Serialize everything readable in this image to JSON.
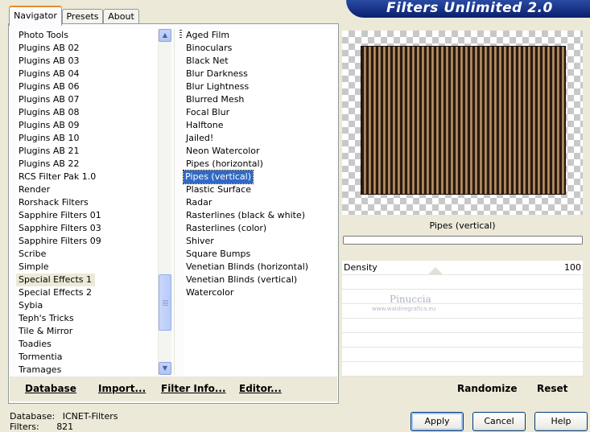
{
  "banner": {
    "title": "Filters Unlimited 2.0"
  },
  "tabs": [
    {
      "label": "Navigator",
      "active": true
    },
    {
      "label": "Presets",
      "active": false
    },
    {
      "label": "About",
      "active": false
    }
  ],
  "categories": {
    "items": [
      "Photo Tools",
      "Plugins AB 02",
      "Plugins AB 03",
      "Plugins AB 04",
      "Plugins AB 06",
      "Plugins AB 07",
      "Plugins AB 08",
      "Plugins AB 09",
      "Plugins AB 10",
      "Plugins AB 21",
      "Plugins AB 22",
      "RCS Filter Pak 1.0",
      "Render",
      "Rorshack Filters",
      "Sapphire Filters 01",
      "Sapphire Filters 03",
      "Sapphire Filters 09",
      "Scribe",
      "Simple",
      "Special Effects 1",
      "Special Effects 2",
      "Sybia",
      "Teph's Tricks",
      "Tile & Mirror",
      "Toadies",
      "Tormentia",
      "Tramages"
    ],
    "selected_index": 19
  },
  "filters": {
    "items": [
      "Aged Film",
      "Binoculars",
      "Black Net",
      "Blur Darkness",
      "Blur Lightness",
      "Blurred Mesh",
      "Focal Blur",
      "Halftone",
      "Jailed!",
      "Neon Watercolor",
      "Pipes (horizontal)",
      "Pipes (vertical)",
      "Plastic Surface",
      "Radar",
      "Rasterlines (black & white)",
      "Rasterlines (color)",
      "Shiver",
      "Square Bumps",
      "Venetian Blinds (horizontal)",
      "Venetian Blinds (vertical)",
      "Watercolor"
    ],
    "selected_index": 11
  },
  "left_buttons": {
    "database": "Database",
    "import": "Import...",
    "filter_info": "Filter Info...",
    "editor": "Editor..."
  },
  "preview": {
    "filter_name": "Pipes (vertical)",
    "progress": 0,
    "watermark_name": "Pinuccia",
    "watermark_url": "www.waldiregrafica.eu"
  },
  "parameters": [
    {
      "label": "Density",
      "value": "100"
    }
  ],
  "right_buttons": {
    "randomize": "Randomize",
    "reset": "Reset"
  },
  "status": {
    "database_label": "Database:",
    "database_value": "ICNET-Filters",
    "filters_label": "Filters:",
    "filters_value": "821"
  },
  "dialog_buttons": {
    "apply": "Apply",
    "cancel": "Cancel",
    "help": "Help"
  }
}
